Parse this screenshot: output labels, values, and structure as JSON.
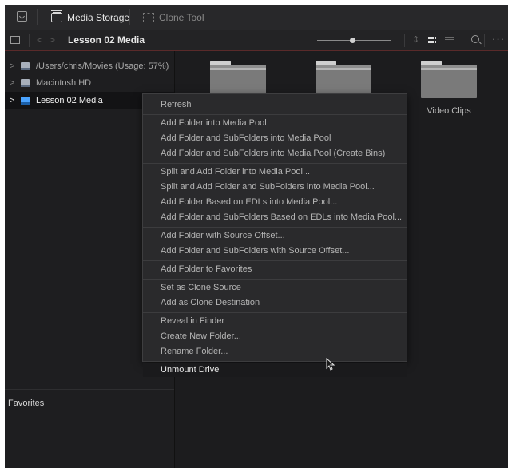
{
  "toolbar": {
    "media_storage_label": "Media Storage",
    "clone_tool_label": "Clone Tool"
  },
  "pathbar": {
    "title": "Lesson 02 Media",
    "zoom_fraction": 0.48
  },
  "sidebar": {
    "items": [
      {
        "label": "/Users/chris/Movies (Usage: 57%)",
        "selected": false
      },
      {
        "label": "Macintosh HD",
        "selected": false
      },
      {
        "label": "Lesson 02 Media",
        "selected": true
      }
    ],
    "favorites_title": "Favorites"
  },
  "content": {
    "folders": [
      {
        "label": ""
      },
      {
        "label": ""
      },
      {
        "label": "Video Clips"
      }
    ]
  },
  "context_menu": {
    "groups": [
      [
        "Refresh"
      ],
      [
        "Add Folder into Media Pool",
        "Add Folder and SubFolders into Media Pool",
        "Add Folder and SubFolders into Media Pool (Create Bins)"
      ],
      [
        "Split and Add Folder into Media Pool...",
        "Split and Add Folder and SubFolders into Media Pool...",
        "Add Folder Based on EDLs into Media Pool...",
        "Add Folder and SubFolders Based on EDLs into Media Pool..."
      ],
      [
        "Add Folder with Source Offset...",
        "Add Folder and SubFolders with Source Offset..."
      ],
      [
        "Add Folder to Favorites"
      ],
      [
        "Set as Clone Source",
        "Add as Clone Destination"
      ],
      [
        "Reveal in Finder",
        "Create New Folder...",
        "Rename Folder..."
      ],
      [
        "Unmount Drive"
      ]
    ],
    "highlighted": "Unmount Drive"
  }
}
